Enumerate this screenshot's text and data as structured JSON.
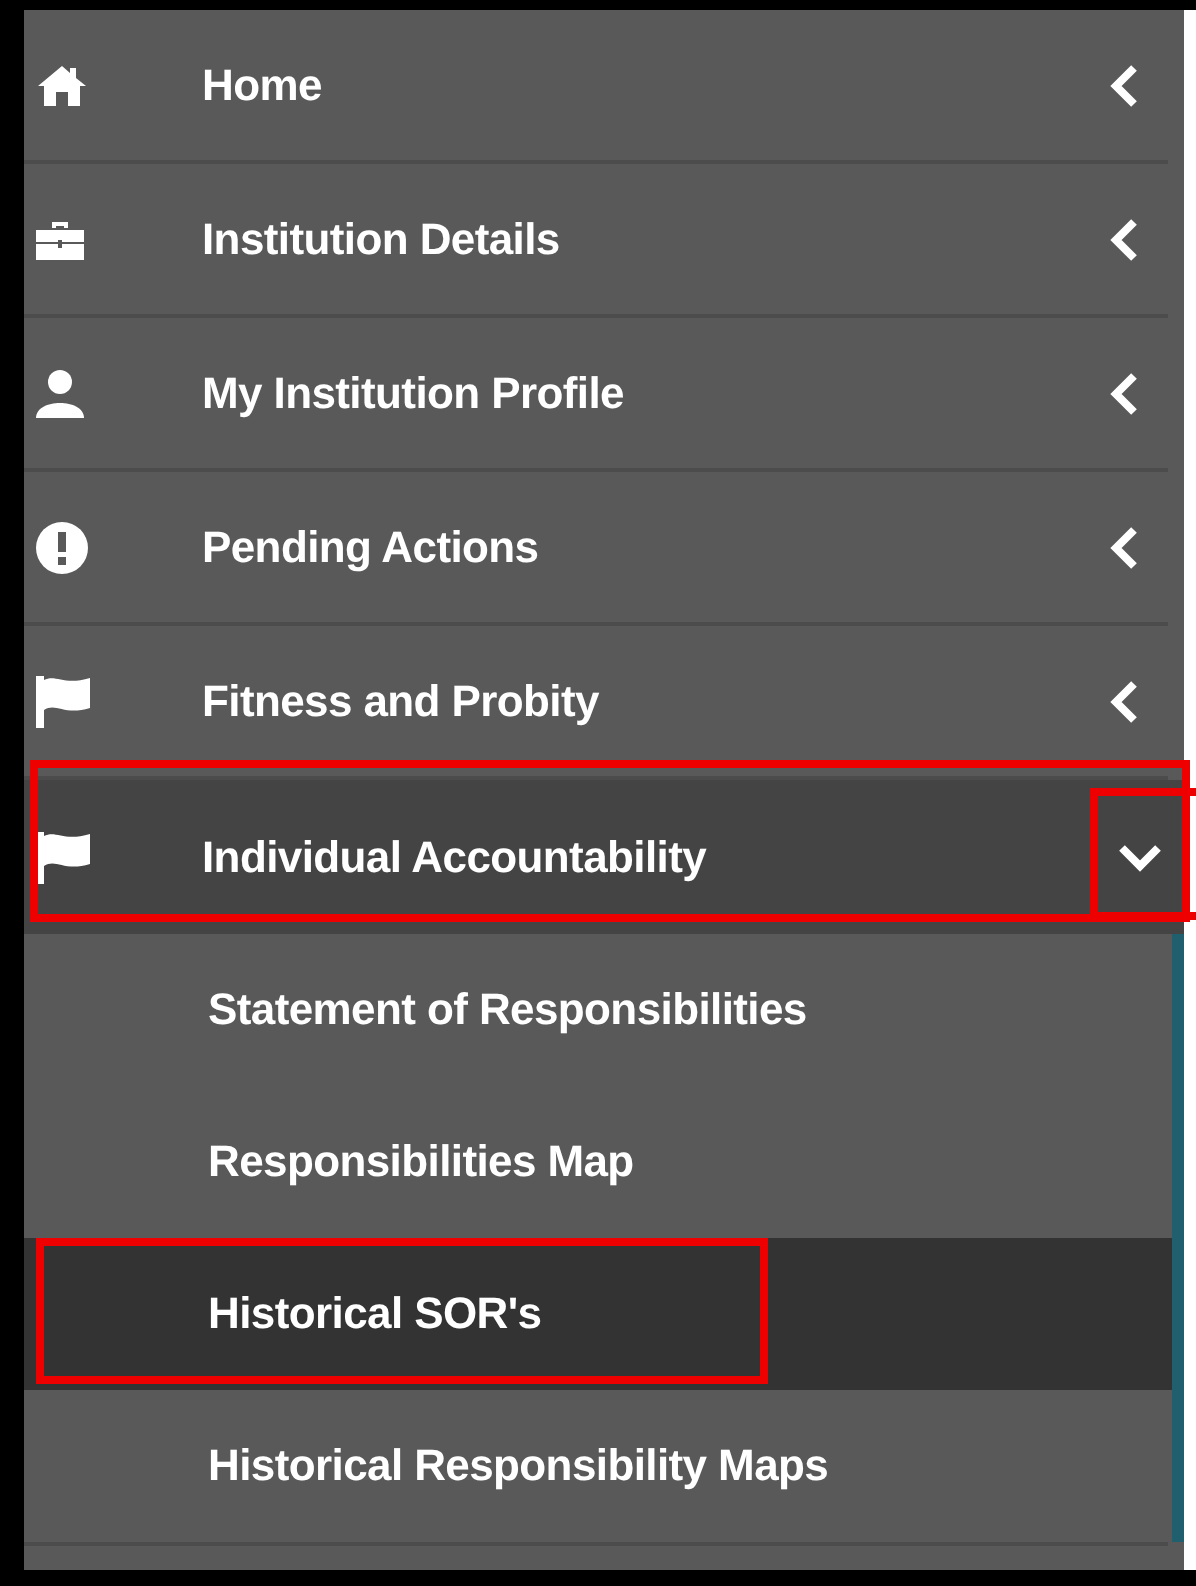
{
  "menu": {
    "items": [
      {
        "label": "Home",
        "expanded": false,
        "annotated": false
      },
      {
        "label": "Institution Details",
        "expanded": false,
        "annotated": false
      },
      {
        "label": "My Institution Profile",
        "expanded": false,
        "annotated": false
      },
      {
        "label": "Pending Actions",
        "expanded": false,
        "annotated": false
      },
      {
        "label": "Fitness and Probity",
        "expanded": false,
        "annotated": false
      },
      {
        "label": "Individual Accountability",
        "expanded": true,
        "annotated": true,
        "children": [
          {
            "label": "Statement of Responsibilities",
            "selected": false,
            "annotated": false
          },
          {
            "label": "Responsibilities Map",
            "selected": false,
            "annotated": false
          },
          {
            "label": "Historical SOR's",
            "selected": true,
            "annotated": true
          },
          {
            "label": "Historical Responsibility Maps",
            "selected": false,
            "annotated": false
          }
        ]
      }
    ]
  }
}
